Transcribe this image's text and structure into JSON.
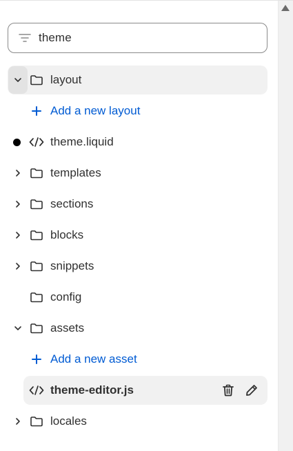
{
  "search": {
    "value": "theme",
    "icon": "filter-lines-icon"
  },
  "tree": {
    "layout": {
      "label": "layout",
      "expanded": true,
      "selected": true
    },
    "add_layout": {
      "label": "Add a new layout"
    },
    "theme_liquid": {
      "label": "theme.liquid",
      "modified": true
    },
    "templates": {
      "label": "templates",
      "expanded": false
    },
    "sections": {
      "label": "sections",
      "expanded": false
    },
    "blocks": {
      "label": "blocks",
      "expanded": false
    },
    "snippets": {
      "label": "snippets",
      "expanded": false
    },
    "config": {
      "label": "config"
    },
    "assets": {
      "label": "assets",
      "expanded": true
    },
    "add_asset": {
      "label": "Add a new asset"
    },
    "theme_editor": {
      "label": "theme-editor.js",
      "active": true
    },
    "locales": {
      "label": "locales",
      "expanded": false
    }
  },
  "colors": {
    "link": "#005bd3",
    "text": "#303030",
    "row_highlight": "#f1f1f1"
  }
}
